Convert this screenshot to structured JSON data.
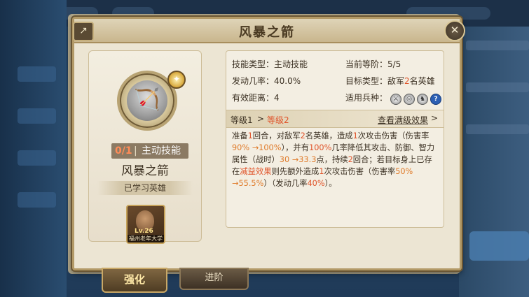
{
  "window": {
    "title": "风暴之箭"
  },
  "skill": {
    "count": "0/1",
    "divider": "|",
    "type_label": "主动技能",
    "name": "风暴之箭",
    "learned_label": "已学习英雄",
    "hero": {
      "level_badge": "Lv.26",
      "name": "福州老年大学"
    }
  },
  "attrs": {
    "skill_type": "技能类型：主动技能",
    "rank": "当前等阶：5/5",
    "trigger_rate": "发动几率：40.0%",
    "target_prefix": "目标类型：敌军",
    "target_num": "2",
    "target_suffix": "名英雄",
    "range": "有效距离：4",
    "troop_label": "适用兵种：",
    "troop_icons": [
      "sword-icon",
      "shield-icon",
      "horse-icon",
      "help-icon"
    ]
  },
  "level": {
    "from": "等级1",
    "arrow": ">",
    "to": "等级2",
    "max_link": "查看满级效果",
    "max_chevron": ">"
  },
  "description": {
    "p1": "准备",
    "n1": "1",
    "p2": "回合，对敌军",
    "n2": "2",
    "p3": "名英雄，造成",
    "n3": "1",
    "p4": "次攻击伤害（伤害率",
    "v1": "90% →100%",
    "p5": "），并有",
    "v2": "100%",
    "p6": "几率降低其攻击、防御、智力属性（战时）",
    "v3": "30 →33.3",
    "p7": "点，持续",
    "n4": "2",
    "p8": "回合；若目标身上已存在",
    "debuff": "减益效果",
    "p9": "则先额外造成",
    "n5": "1",
    "p10": "次攻击伤害（伤害率",
    "v4": "50% →55.5%",
    "p11": "）（发动几率",
    "v5": "40%",
    "p12": "）。"
  },
  "tabs": {
    "strengthen": "强化",
    "advance": "进阶"
  },
  "colors": {
    "highlight_red": "#e0542a",
    "highlight_orange": "#e07b2a",
    "frame_gold": "#b39a67"
  }
}
